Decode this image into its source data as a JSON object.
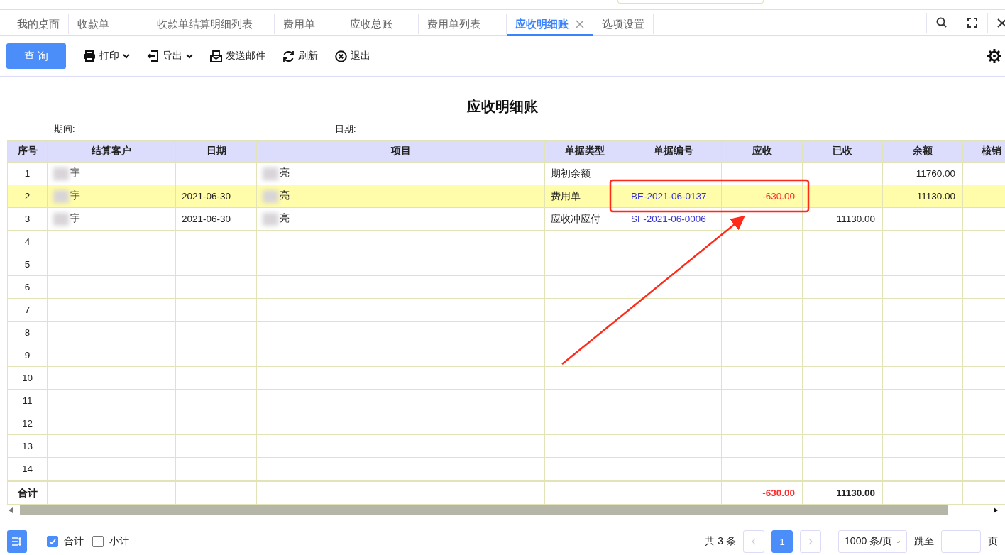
{
  "tabs": [
    {
      "label": "我的桌面",
      "selected": false,
      "closable": false
    },
    {
      "label": "收款单",
      "selected": false,
      "closable": false
    },
    {
      "label": "收款单结算明细列表",
      "selected": false,
      "closable": false
    },
    {
      "label": "费用单",
      "selected": false,
      "closable": false
    },
    {
      "label": "应收总账",
      "selected": false,
      "closable": false
    },
    {
      "label": "费用单列表",
      "selected": false,
      "closable": false
    },
    {
      "label": "应收明细账",
      "selected": true,
      "closable": true
    },
    {
      "label": "选项设置",
      "selected": false,
      "closable": false
    }
  ],
  "toolbar": [
    {
      "kind": "primary",
      "label": "查 询"
    },
    {
      "kind": "print",
      "label": "打印",
      "dropdown": true
    },
    {
      "kind": "export",
      "label": "导出",
      "dropdown": true
    },
    {
      "kind": "mail",
      "label": "发送邮件",
      "dropdown": false
    },
    {
      "kind": "refresh",
      "label": "刷新",
      "dropdown": false
    },
    {
      "kind": "exit",
      "label": "退出",
      "dropdown": false
    }
  ],
  "report": {
    "title": "应收明细账",
    "period_label": "期间:",
    "date_label": "日期:"
  },
  "table": {
    "columns": [
      "序号",
      "结算客户",
      "日期",
      "项目",
      "单据类型",
      "单据编号",
      "应收",
      "已收",
      "余额",
      "核销"
    ],
    "rows": [
      {
        "no": "1",
        "customer": "宇",
        "item": "亮",
        "doc_type": "期初余额",
        "balance": "11760.00",
        "selected": false
      },
      {
        "no": "2",
        "customer": "宇",
        "date": "2021-06-30",
        "item": "亮",
        "doc_type": "费用单",
        "doc_no": "BE-2021-06-0137",
        "receivable": "-630.00",
        "balance": "11130.00",
        "selected": true
      },
      {
        "no": "3",
        "customer": "宇",
        "date": "2021-06-30",
        "item": "亮",
        "doc_type": "应收冲应付",
        "doc_no": "SF-2021-06-0006",
        "received": "11130.00",
        "selected": false
      },
      {
        "no": "4",
        "selected": false
      },
      {
        "no": "5",
        "selected": false
      },
      {
        "no": "6",
        "selected": false
      },
      {
        "no": "7",
        "selected": false
      },
      {
        "no": "8",
        "selected": false
      },
      {
        "no": "9",
        "selected": false
      },
      {
        "no": "10",
        "selected": false
      },
      {
        "no": "11",
        "selected": false
      },
      {
        "no": "12",
        "selected": false
      },
      {
        "no": "13",
        "selected": false
      },
      {
        "no": "14",
        "selected": false
      }
    ],
    "total": {
      "label": "合计",
      "receivable": "-630.00",
      "received": "11130.00"
    }
  },
  "footer": {
    "options": [
      {
        "label": "合计",
        "checked": true
      },
      {
        "label": "小计",
        "checked": false
      }
    ],
    "total_text": "共 3 条",
    "pages": [
      {
        "label": "1",
        "selected": true
      }
    ],
    "page_size": "1000 条/页",
    "jump_label": "跳至",
    "page_unit": "页"
  }
}
